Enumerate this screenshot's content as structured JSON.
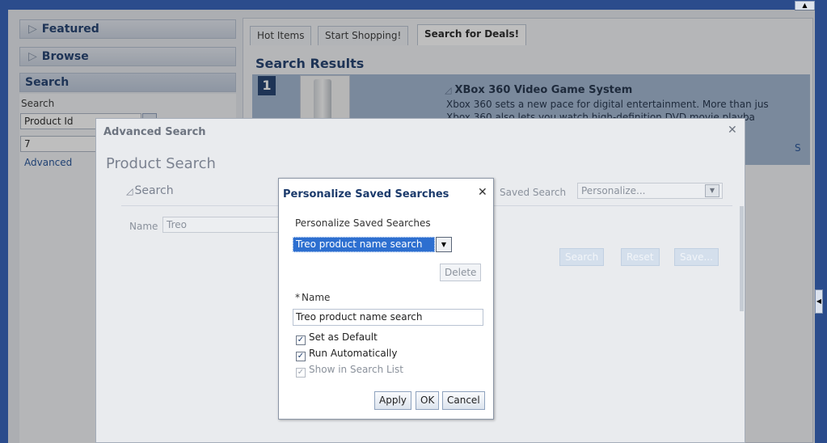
{
  "window": {
    "scroll_up_glyph": "▲",
    "collapse_glyph": "◀"
  },
  "accordion": {
    "featured": "Featured",
    "browse": "Browse",
    "search": "Search",
    "chevron": "▷"
  },
  "left_search": {
    "label": "Search",
    "field_a_value": "Product Id",
    "field_b_value": "7",
    "advanced_link": "Advanced"
  },
  "tabs": [
    "Hot Items",
    "Start Shopping!",
    "Search for Deals!"
  ],
  "results": {
    "heading": "Search Results",
    "rank": "1",
    "title_tri": "◿",
    "title": "XBox 360 Video Game System",
    "desc_line1": "Xbox 360 sets a new pace for digital entertainment. More than jus",
    "desc_line2": "Xbox 360 also lets you watch high-definition DVD movie playba",
    "link": "S"
  },
  "advanced_dialog": {
    "title": "Advanced Search",
    "close": "✕",
    "heading": "Product Search",
    "search_section": "Search",
    "name_label": "Name",
    "name_value": "Treo",
    "saved_search_label": "Saved Search",
    "saved_search_value": "Personalize...",
    "buttons": [
      "Search",
      "Reset",
      "Save..."
    ]
  },
  "personalize_dialog": {
    "title": "Personalize Saved Searches",
    "close": "✕",
    "subtitle": "Personalize Saved Searches",
    "selected_search": "Treo product name search",
    "select_arrow": "▼",
    "delete_label": "Delete",
    "required_mark": "*",
    "name_label": "Name",
    "name_value": "Treo product name search",
    "checkboxes": [
      {
        "label": "Set as Default",
        "checked": true
      },
      {
        "label": "Run Automatically",
        "checked": true
      },
      {
        "label": "Show in Search List",
        "checked": true,
        "disabled": true
      }
    ],
    "check_glyph": "✓",
    "buttons": {
      "apply": "Apply",
      "ok": "OK",
      "cancel": "Cancel"
    }
  }
}
